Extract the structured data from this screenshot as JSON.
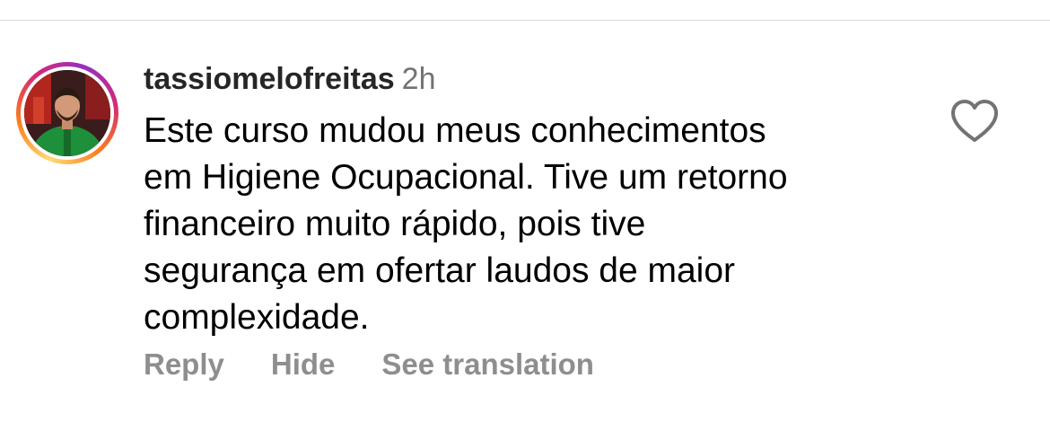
{
  "comment": {
    "username": "tassiomelofreitas",
    "timestamp": "2h",
    "text_lines": [
      "Este curso mudou meus conhecimentos",
      "em Higiene Ocupacional. Tive um retorno",
      "financeiro muito rápido, pois tive",
      "segurança em ofertar laudos de maior",
      "complexidade."
    ],
    "liked": false
  },
  "actions": {
    "reply_label": "Reply",
    "hide_label": "Hide",
    "translate_label": "See translation"
  },
  "icons": {
    "like": "heart-outline-icon"
  },
  "colors": {
    "username": "#262626",
    "secondary": "#737373",
    "action": "#8e8e8e",
    "divider": "#dbdbdb",
    "story_ring": [
      "#feda75",
      "#fa7e1e",
      "#d62976",
      "#962fbf"
    ]
  }
}
